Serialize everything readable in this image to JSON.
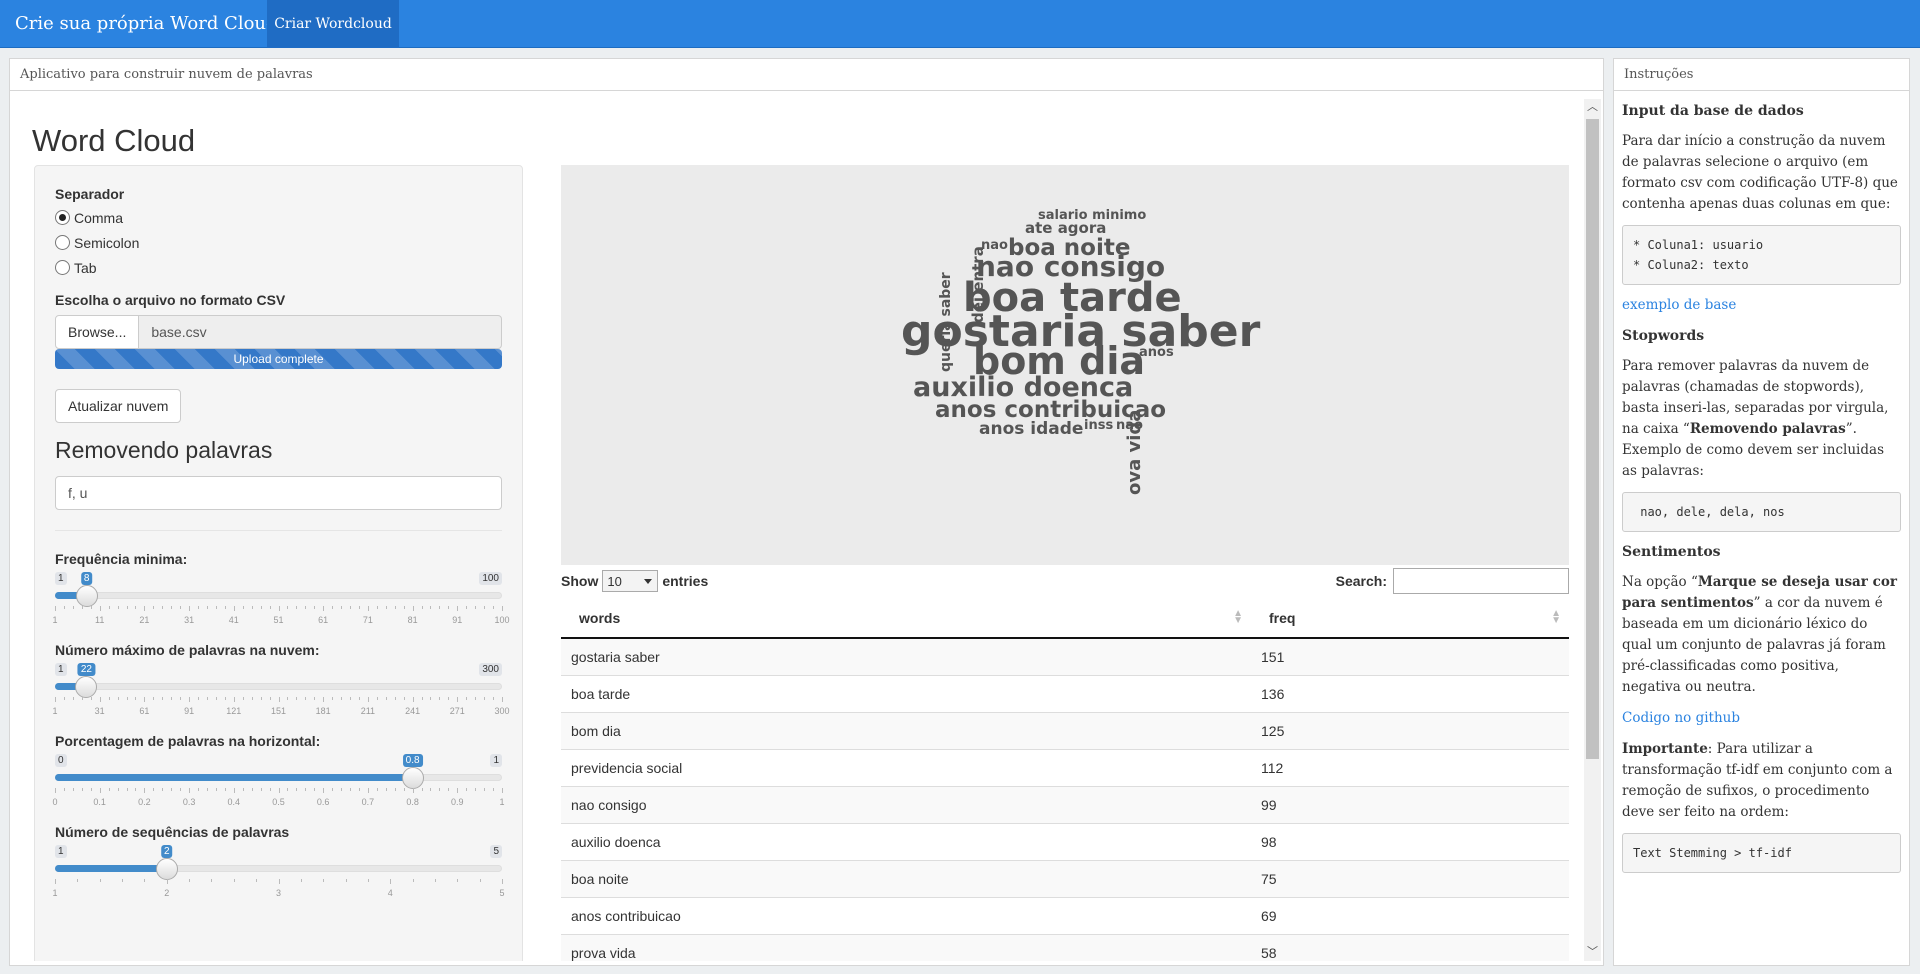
{
  "navbar": {
    "brand": "Crie sua própria Word Cloud",
    "tab": "Criar Wordcloud",
    "bg_color": "#2b83e0"
  },
  "main": {
    "header": "Aplicativo para construir nuvem de palavras",
    "title": "Word Cloud"
  },
  "sidebar": {
    "separator_label": "Separador",
    "separator_options": [
      "Comma",
      "Semicolon",
      "Tab"
    ],
    "separator_selected": "Comma",
    "file_label": "Escolha o arquivo no formato CSV",
    "browse_label": "Browse...",
    "file_name": "base.csv",
    "upload_status": "Upload complete",
    "update_button": "Atualizar nuvem",
    "remove_title": "Removendo palavras",
    "remove_value": "f, u",
    "sliders": [
      {
        "label": "Frequência minima:",
        "min": "1",
        "max": "100",
        "value": "8",
        "fraction": 0.0707,
        "ticks": [
          "1",
          "11",
          "21",
          "31",
          "41",
          "51",
          "61",
          "71",
          "81",
          "91",
          "100"
        ]
      },
      {
        "label": "Número máximo de palavras na nuvem:",
        "min": "1",
        "max": "300",
        "value": "22",
        "fraction": 0.0702,
        "ticks": [
          "1",
          "31",
          "61",
          "91",
          "121",
          "151",
          "181",
          "211",
          "241",
          "271",
          "300"
        ]
      },
      {
        "label": "Porcentagem de palavras na horizontal:",
        "min": "0",
        "max": "1",
        "value": "0.8",
        "fraction": 0.8,
        "ticks": [
          "0",
          "0.1",
          "0.2",
          "0.3",
          "0.4",
          "0.5",
          "0.6",
          "0.7",
          "0.8",
          "0.9",
          "1"
        ]
      },
      {
        "label": "Número de sequências de palavras",
        "min": "1",
        "max": "5",
        "value": "2",
        "fraction": 0.25,
        "ticks": [
          "1",
          "2",
          "3",
          "4",
          "5"
        ]
      }
    ]
  },
  "cloud_words": [
    {
      "text": "gostaria saber",
      "size": 44,
      "vertical": false
    },
    {
      "text": "boa tarde",
      "size": 40,
      "vertical": false
    },
    {
      "text": "bom dia",
      "size": 38,
      "vertical": false
    },
    {
      "text": "nao consigo",
      "size": 28,
      "vertical": false
    },
    {
      "text": "auxilio doenca",
      "size": 27,
      "vertical": false
    },
    {
      "text": "anos contribuicao",
      "size": 23,
      "vertical": false
    },
    {
      "text": "boa noite",
      "size": 23,
      "vertical": false
    },
    {
      "text": "ova vida",
      "size": 18,
      "vertical": true
    },
    {
      "text": "anos idade",
      "size": 17,
      "vertical": false
    },
    {
      "text": "ate agora",
      "size": 15,
      "vertical": false
    },
    {
      "text": "salario minimo",
      "size": 13,
      "vertical": false
    },
    {
      "text": "queria saber",
      "size": 14,
      "vertical": true
    },
    {
      "text": "dei entra",
      "size": 15,
      "vertical": true
    },
    {
      "text": "nao",
      "size": 13,
      "vertical": false
    },
    {
      "text": "anos",
      "size": 13,
      "vertical": false
    },
    {
      "text": "inss",
      "size": 13,
      "vertical": false
    },
    {
      "text": "nao",
      "size": 13,
      "vertical": false
    }
  ],
  "table": {
    "show_label": "Show",
    "entries_value": "10",
    "entries_label": "entries",
    "search_label": "Search:",
    "columns": [
      "words",
      "freq"
    ],
    "rows": [
      [
        "gostaria saber",
        "151"
      ],
      [
        "boa tarde",
        "136"
      ],
      [
        "bom dia",
        "125"
      ],
      [
        "previdencia social",
        "112"
      ],
      [
        "nao consigo",
        "99"
      ],
      [
        "auxilio doenca",
        "98"
      ],
      [
        "boa noite",
        "75"
      ],
      [
        "anos contribuicao",
        "69"
      ],
      [
        "prova vida",
        "58"
      ]
    ]
  },
  "instructions": {
    "header": "Instruções",
    "input_title": "Input da base de dados",
    "input_text": "Para dar início a construção da nuvem de palavras selecione o arquivo (em formato csv com codificação UTF-8) que contenha apenas duas colunas em que:",
    "input_code": "* Coluna1: usuario\n* Coluna2: texto",
    "example_link": "exemplo de base",
    "stop_title": "Stopwords",
    "stop_text_1": "Para remover palavras da nuvem de palavras (chamadas de stopwords), basta inseri-las, separadas por virgula, na caixa “",
    "stop_text_bold": "Removendo palavras",
    "stop_text_2": "”. Exemplo de como devem ser incluidas as palavras:",
    "stop_code": " nao, dele, dela, nos",
    "sent_title": "Sentimentos",
    "sent_text_1": "Na opção “",
    "sent_text_bold": "Marque se deseja usar cor para sentimentos",
    "sent_text_2": "” a cor da nuvem é baseada em um dicionário léxico do qual um conjunto de palavras já foram pré-classificadas como positiva, negativa ou neutra.",
    "github_link": "Codigo no github",
    "important_bold": "Importante",
    "important_text": ": Para utilizar a transformação tf-idf em conjunto com a remoção de sufixos, o procedimento deve ser feito na ordem:",
    "important_code": "Text Stemming > tf-idf"
  }
}
